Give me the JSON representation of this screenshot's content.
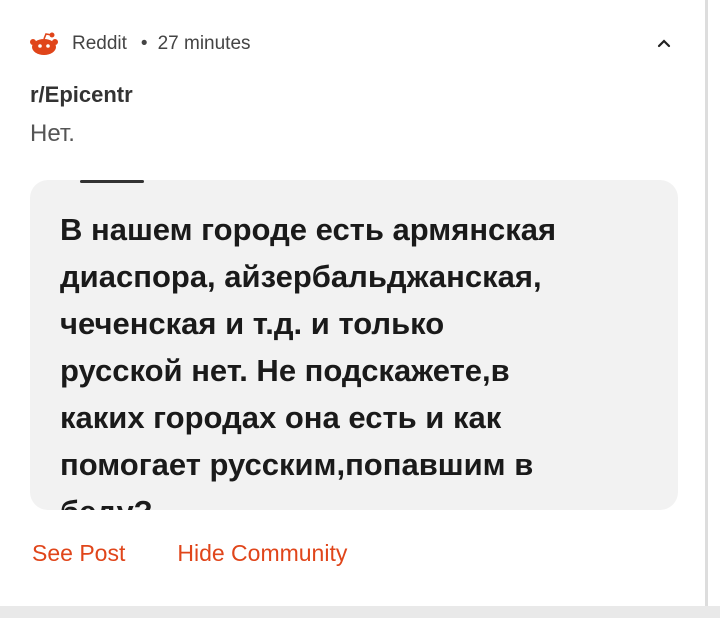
{
  "notification": {
    "app_name": "Reddit",
    "separator": "•",
    "time": "27 minutes",
    "app_icon": "reddit-alien-icon",
    "expand_icon": "chevron-up-icon",
    "subreddit": "r/Epicentr",
    "body": "Нет.",
    "preview_text": "В нашем городе есть армянская\nдиаспора, айзербальджанская,\nчеченская и т.д. и только\nрусской нет. Не подскажете,в\nкаких городах она есть и как\nпомогает русским,попавшим в\nбеду?",
    "actions": {
      "see_post": "See Post",
      "hide_community": "Hide Community"
    }
  },
  "colors": {
    "accent": "#e0451a",
    "card_bg": "#ffffff",
    "preview_bg": "#f2f2f2"
  }
}
